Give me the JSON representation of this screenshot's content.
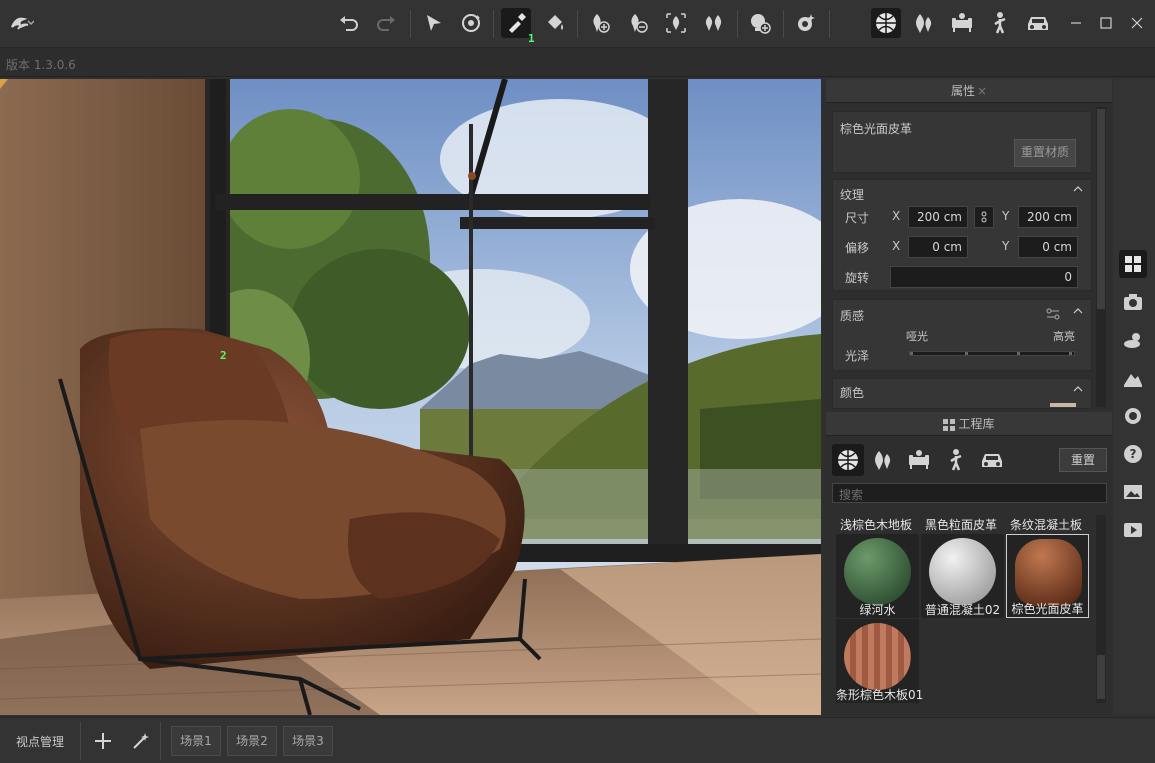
{
  "app": {
    "version": "版本 1.3.0.6"
  },
  "toolbar": {
    "badge_1": "1",
    "icons": [
      "logo-icon",
      "undo-icon",
      "redo-icon",
      "select-arrow-icon",
      "orbit-icon",
      "eyedropper-icon",
      "paint-bucket-icon",
      "add-tree-icon",
      "remove-tree-icon",
      "scatter-tree-icon",
      "plants-icon",
      "add-light-icon",
      "sun-settings-icon",
      "material-library-icon",
      "vegetation-library-icon",
      "furniture-library-icon",
      "people-library-icon",
      "vehicle-library-icon"
    ],
    "window": [
      "minimize",
      "maximize",
      "close"
    ]
  },
  "viewport": {
    "badge_2": "2"
  },
  "properties": {
    "title": "属性",
    "close": "×",
    "material_name": "棕色光面皮革",
    "reset_material": "重置材质",
    "texture": {
      "label": "纹理",
      "size_label": "尺寸",
      "x": "X",
      "y": "Y",
      "size_x": "200 cm",
      "size_y": "200 cm",
      "offset_label": "偏移",
      "offset_x": "0 cm",
      "offset_y": "0 cm",
      "rotation_label": "旋转",
      "rotation": "0"
    },
    "quality": {
      "label": "质感",
      "matte": "哑光",
      "glossy": "高亮",
      "gloss_label": "光泽"
    },
    "color": {
      "label": "颜色"
    }
  },
  "library": {
    "title": "工程库",
    "reset": "重置",
    "search_placeholder": "搜索",
    "top_row": [
      "浅棕色木地板",
      "黑色粒面皮革",
      "条纹混凝土板"
    ],
    "materials": [
      {
        "name": "绿河水",
        "color": "#2f5a34"
      },
      {
        "name": "普通混凝土02",
        "color": "#d4d4d4"
      },
      {
        "name": "棕色光面皮革",
        "color": "#8a4a2a",
        "selected": true
      },
      {
        "name": "条形棕色木板01",
        "color": "#a06048"
      }
    ]
  },
  "bottom": {
    "viewpoint": "视点管理",
    "scenes": [
      "场景1",
      "场景2",
      "场景3"
    ]
  },
  "colors": {
    "accent_badge": "#4cff6a",
    "panel": "#2e2e2e",
    "toolbar": "#333333"
  }
}
